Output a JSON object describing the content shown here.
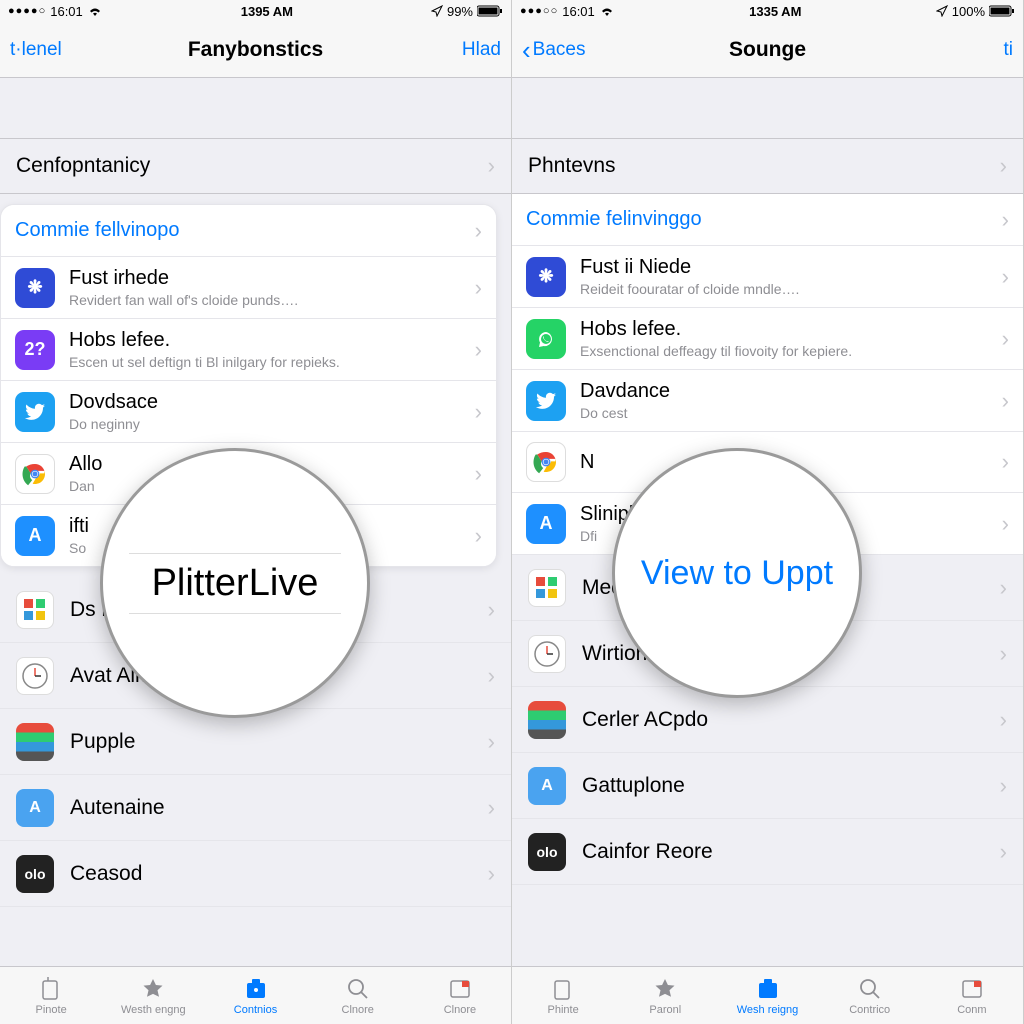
{
  "left": {
    "status": {
      "dots": "●●●●○",
      "carrier": "16:01",
      "time": "1395 AM",
      "battery": "99%"
    },
    "nav": {
      "left": "t·lenel",
      "title": "Fanybonstics",
      "right": "Hlad"
    },
    "section": "Cenfopntanicy",
    "card_header": "Commie fellvinopo",
    "apps": [
      {
        "title": "Fust irhede",
        "sub": "Revidert fan wall of's cloide punds…."
      },
      {
        "title": "Hobs lefee.",
        "sub": "Escen ut sel deftign ti Bl inilgary for repieks."
      },
      {
        "title": "Dovdsace",
        "sub": "Do neginny"
      },
      {
        "title": "Allo",
        "sub": "Dan"
      },
      {
        "title": "ifti",
        "sub": "So"
      }
    ],
    "simple": [
      {
        "title": "Ds n"
      },
      {
        "title": "Avat Almre"
      },
      {
        "title": "Pupple"
      },
      {
        "title": "Autenaine"
      },
      {
        "title": "Ceasod"
      }
    ],
    "magnifier": "PlitterLive"
  },
  "right": {
    "status": {
      "dots": "●●●○○",
      "carrier": "16:01",
      "time": "1335 AM",
      "battery": "100%"
    },
    "nav": {
      "left": "Baces",
      "title": "Sounge",
      "right": "ti"
    },
    "section": "Phntevns",
    "card_header": "Commie felinvinggo",
    "apps": [
      {
        "title": "Fust ii Niede",
        "sub": "Reideit foouratar of cloide mndle…."
      },
      {
        "title": "Hobs lefee.",
        "sub": "Exsenctional deffeagy til fiovoity for kepiere."
      },
      {
        "title": "Davdance",
        "sub": "Do cest"
      },
      {
        "title": "N",
        "sub": ""
      },
      {
        "title": "Slinipli acc le ineroq",
        "sub": "Dfi"
      }
    ],
    "simple": [
      {
        "title": "Međõe"
      },
      {
        "title": "Wirtion Dose"
      },
      {
        "title": "Cerler ACpdo"
      },
      {
        "title": "Gattuplone"
      },
      {
        "title": "Cainfor Reore"
      }
    ],
    "magnifier": "View to Uppt"
  },
  "tabs": [
    {
      "label": "Pinote"
    },
    {
      "label": "Westh engng"
    },
    {
      "label": "Contnios"
    },
    {
      "label": "Clnore"
    }
  ],
  "tabs_right": [
    {
      "label": "Phinte"
    },
    {
      "label": "Paronl"
    },
    {
      "label": "Wesh reigng"
    },
    {
      "label": "Contrico"
    },
    {
      "label": "Conm"
    }
  ]
}
